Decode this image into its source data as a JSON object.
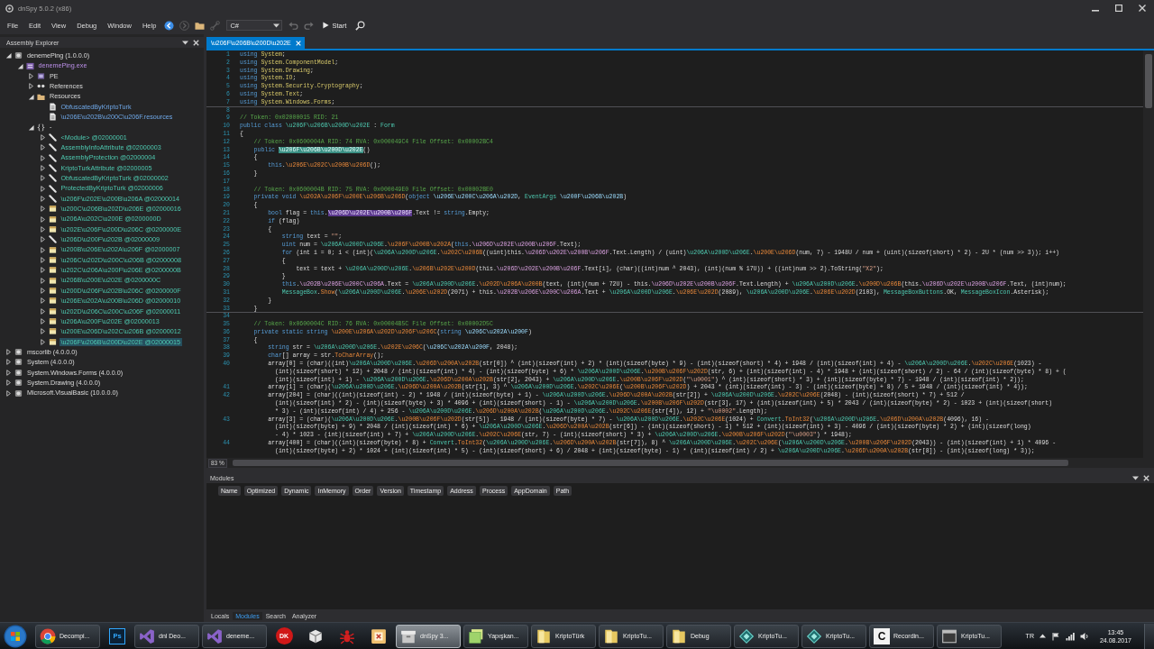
{
  "window": {
    "title": "dnSpy 5.0.2 (x86)"
  },
  "menu": [
    "File",
    "Edit",
    "View",
    "Debug",
    "Window",
    "Help"
  ],
  "toolbar": [
    {
      "kind": "back",
      "disabled": false
    },
    {
      "kind": "forward",
      "disabled": true
    },
    {
      "kind": "open",
      "disabled": false
    },
    {
      "kind": "link",
      "disabled": true
    },
    {
      "kind": "language",
      "value": "C#",
      "disabled": false
    },
    {
      "kind": "undo",
      "disabled": true
    },
    {
      "kind": "redo",
      "disabled": true
    },
    {
      "kind": "start",
      "label": "Start",
      "disabled": false
    },
    {
      "kind": "search",
      "disabled": false
    }
  ],
  "assembly_explorer": {
    "title": "Assembly Explorer",
    "tree": [
      {
        "label": "denemePing (1.0.0.0)",
        "kind": "assembly",
        "expanded": true,
        "selected": false,
        "children": [
          {
            "label": "denemePing.exe",
            "kind": "module",
            "expanded": true,
            "selected": false,
            "children": [
              {
                "label": "PE",
                "kind": "pe",
                "expanded": false,
                "selected": false
              },
              {
                "label": "References",
                "kind": "references",
                "expanded": false,
                "selected": false
              },
              {
                "label": "Resources",
                "kind": "resources",
                "expanded": true,
                "selected": false,
                "children": [
                  {
                    "label": "ObfuscatedByKriptoTurk",
                    "kind": "resource",
                    "selected": false
                  },
                  {
                    "label": "\\u206E\\u202B\\u200C\\u206F.resources",
                    "kind": "resource",
                    "selected": false
                  }
                ]
              },
              {
                "label": "-",
                "kind": "namespace",
                "expanded": true,
                "selected": false,
                "children": [
                  {
                    "label": "<Module> @02000001",
                    "kind": "class",
                    "expanded": false,
                    "selected": false
                  },
                  {
                    "label": "AssemblyInfoAttribute @02000003",
                    "kind": "class",
                    "expanded": false,
                    "selected": false
                  },
                  {
                    "label": "AssemblyProtection @02000004",
                    "kind": "class",
                    "expanded": false,
                    "selected": false
                  },
                  {
                    "label": "KriptoTurkAttribute @02000005",
                    "kind": "class",
                    "expanded": false,
                    "selected": false
                  },
                  {
                    "label": "ObfuscatedByKriptoTurk @02000002",
                    "kind": "class",
                    "expanded": false,
                    "selected": false
                  },
                  {
                    "label": "ProtectedByKriptoTurk @02000006",
                    "kind": "class",
                    "expanded": false,
                    "selected": false
                  },
                  {
                    "label": "\\u206F\\u202E\\u200B\\u206A @02000014",
                    "kind": "class",
                    "expanded": false,
                    "selected": false
                  },
                  {
                    "label": "\\u200C\\u206B\\u202D\\u206E @02000016",
                    "kind": "form",
                    "expanded": false,
                    "selected": false
                  },
                  {
                    "label": "\\u206A\\u202C\\u200E @0200000D",
                    "kind": "form",
                    "expanded": false,
                    "selected": false
                  },
                  {
                    "label": "\\u202E\\u206F\\u200D\\u206C @0200000E",
                    "kind": "form",
                    "expanded": false,
                    "selected": false
                  },
                  {
                    "label": "\\u206D\\u200F\\u202B @02000009",
                    "kind": "class",
                    "expanded": false,
                    "selected": false
                  },
                  {
                    "label": "\\u200B\\u206E\\u202A\\u206F @02000007",
                    "kind": "form",
                    "expanded": false,
                    "selected": false
                  },
                  {
                    "label": "\\u206C\\u202D\\u200C\\u206B @02000008",
                    "kind": "form",
                    "expanded": false,
                    "selected": false
                  },
                  {
                    "label": "\\u202C\\u206A\\u200F\\u206E @0200000B",
                    "kind": "form",
                    "expanded": false,
                    "selected": false
                  },
                  {
                    "label": "\\u206B\\u200E\\u202E @0200000C",
                    "kind": "form",
                    "expanded": false,
                    "selected": false
                  },
                  {
                    "label": "\\u200D\\u206F\\u202B\\u206C @0200000F",
                    "kind": "form",
                    "expanded": false,
                    "selected": false
                  },
                  {
                    "label": "\\u206E\\u202A\\u200B\\u206D @02000010",
                    "kind": "form",
                    "expanded": false,
                    "selected": false
                  },
                  {
                    "label": "\\u202D\\u206C\\u200C\\u206F @02000011",
                    "kind": "form",
                    "expanded": false,
                    "selected": false
                  },
                  {
                    "label": "\\u206A\\u200F\\u202E @02000013",
                    "kind": "form",
                    "expanded": false,
                    "selected": false
                  },
                  {
                    "label": "\\u200E\\u206D\\u202C\\u206B @02000012",
                    "kind": "form",
                    "expanded": false,
                    "selected": false
                  },
                  {
                    "label": "\\u206F\\u206B\\u200D\\u202E @02000015",
                    "kind": "form",
                    "expanded": false,
                    "selected": true
                  }
                ]
              }
            ]
          }
        ]
      },
      {
        "label": "mscorlib (4.0.0.0)",
        "kind": "assembly",
        "expanded": false,
        "selected": false
      },
      {
        "label": "System (4.0.0.0)",
        "kind": "assembly",
        "expanded": false,
        "selected": false
      },
      {
        "label": "System.Windows.Forms (4.0.0.0)",
        "kind": "assembly",
        "expanded": false,
        "selected": false
      },
      {
        "label": "System.Drawing (4.0.0.0)",
        "kind": "assembly",
        "expanded": false,
        "selected": false
      },
      {
        "label": "Microsoft.VisualBasic (10.0.0.0)",
        "kind": "assembly",
        "expanded": false,
        "selected": false
      }
    ]
  },
  "editor": {
    "tabs": [
      {
        "label": "\\u206F\\u206B\\u200D\\u202E",
        "selected": true
      }
    ],
    "lines": [
      {
        "number": "1",
        "segments": [
          {
            "kind": "keyword",
            "text": "using "
          },
          {
            "kind": "namespace",
            "text": "System"
          },
          {
            "kind": "plain",
            "text": ";"
          }
        ]
      },
      {
        "number": "2",
        "segments": [
          {
            "kind": "keyword",
            "text": "using "
          },
          {
            "kind": "namespace",
            "text": "System.ComponentModel"
          },
          {
            "kind": "plain",
            "text": ";"
          }
        ]
      },
      {
        "number": "3",
        "segments": [
          {
            "kind": "keyword",
            "text": "using "
          },
          {
            "kind": "namespace",
            "text": "System.Drawing"
          },
          {
            "kind": "plain",
            "text": ";"
          }
        ]
      },
      {
        "number": "4",
        "segments": [
          {
            "kind": "keyword",
            "text": "using "
          },
          {
            "kind": "namespace",
            "text": "System.IO"
          },
          {
            "kind": "plain",
            "text": ";"
          }
        ]
      },
      {
        "number": "5",
        "segments": [
          {
            "kind": "keyword",
            "text": "using "
          },
          {
            "kind": "namespace",
            "text": "System.Security.Cryptography"
          },
          {
            "kind": "plain",
            "text": ";"
          }
        ]
      },
      {
        "number": "6",
        "segments": [
          {
            "kind": "keyword",
            "text": "using "
          },
          {
            "kind": "namespace",
            "text": "System.Text"
          },
          {
            "kind": "plain",
            "text": ";"
          }
        ]
      },
      {
        "number": "7",
        "segments": [
          {
            "kind": "keyword",
            "text": "using "
          },
          {
            "kind": "namespace",
            "text": "System.Windows.Forms"
          },
          {
            "kind": "plain",
            "text": ";"
          }
        ],
        "divider_below": true
      },
      {
        "number": "8"
      },
      {
        "number": "9",
        "segments": [
          {
            "kind": "comment",
            "text": "// Token: 0x02000015 RID: 21"
          }
        ]
      },
      {
        "number": "10",
        "segments": [
          {
            "kind": "keyword",
            "text": "public class "
          },
          {
            "kind": "type",
            "text": "\\u206F\\u206B\\u200D\\u202E"
          },
          {
            "kind": "plain",
            "text": " : "
          },
          {
            "kind": "type",
            "text": "Form"
          }
        ]
      },
      {
        "number": "11",
        "segments": [
          {
            "kind": "plain",
            "text": "{"
          }
        ]
      },
      {
        "number": "12",
        "segments": [
          {
            "kind": "comment",
            "text": "    // Token: 0x0600004A RID: 74 RVA: 0x000049C4 File Offset: 0x00002BC4"
          }
        ]
      },
      {
        "number": "13",
        "segments": [
          {
            "kind": "keyword",
            "text": "    public "
          },
          {
            "kind": "selection",
            "text": "\\u206F\\u206B\\u200D\\u202E"
          },
          {
            "kind": "plain",
            "text": "()"
          }
        ]
      },
      {
        "number": "14",
        "segments": [
          {
            "kind": "plain",
            "text": "    {"
          }
        ]
      },
      {
        "number": "15",
        "segments": [
          {
            "kind": "keyword",
            "text": "        this"
          },
          {
            "kind": "plain",
            "text": "."
          },
          {
            "kind": "method",
            "text": "\\u206E\\u202C\\u200B\\u206D"
          },
          {
            "kind": "plain",
            "text": "();"
          }
        ]
      },
      {
        "number": "16",
        "segments": [
          {
            "kind": "plain",
            "text": "    }"
          }
        ]
      },
      {
        "number": "17"
      },
      {
        "number": "18",
        "segments": [
          {
            "kind": "comment",
            "text": "    // Token: 0x0600004B RID: 75 RVA: 0x000049E0 File Offset: 0x00002BE0"
          }
        ]
      },
      {
        "number": "19",
        "segments": [
          {
            "kind": "keyword",
            "text": "    private void "
          },
          {
            "kind": "method",
            "text": "\\u202A\\u206F\\u200E\\u206B\\u206D"
          },
          {
            "kind": "plain",
            "text": "("
          },
          {
            "kind": "keyword",
            "text": "object "
          },
          {
            "kind": "param",
            "text": "\\u206E\\u200C\\u206A\\u202D"
          },
          {
            "kind": "plain",
            "text": ", "
          },
          {
            "kind": "type",
            "text": "EventArgs "
          },
          {
            "kind": "param",
            "text": "\\u200F\\u206B\\u202B"
          },
          {
            "kind": "plain",
            "text": ")"
          }
        ]
      },
      {
        "number": "20",
        "segments": [
          {
            "kind": "plain",
            "text": "    {"
          }
        ]
      },
      {
        "number": "21",
        "segments": [
          {
            "kind": "keyword",
            "text": "        bool "
          },
          {
            "kind": "plain",
            "text": "flag = "
          },
          {
            "kind": "keyword",
            "text": "this"
          },
          {
            "kind": "plain",
            "text": "."
          },
          {
            "kind": "reference",
            "text": "\\u206D\\u202E\\u200B\\u206F"
          },
          {
            "kind": "plain",
            "text": ".Text != "
          },
          {
            "kind": "keyword",
            "text": "string"
          },
          {
            "kind": "plain",
            "text": ".Empty;"
          }
        ]
      },
      {
        "number": "22",
        "segments": [
          {
            "kind": "keyword",
            "text": "        if "
          },
          {
            "kind": "plain",
            "text": "(flag)"
          }
        ]
      },
      {
        "number": "23",
        "segments": [
          {
            "kind": "plain",
            "text": "        {"
          }
        ]
      },
      {
        "number": "24",
        "segments": [
          {
            "kind": "keyword",
            "text": "            string "
          },
          {
            "kind": "plain",
            "text": "text = "
          },
          {
            "kind": "string",
            "text": "\"\""
          },
          {
            "kind": "plain",
            "text": ";"
          }
        ]
      },
      {
        "number": "25",
        "segments": [
          {
            "kind": "keyword",
            "text": "            uint "
          },
          {
            "kind": "plain",
            "text": "num = "
          },
          {
            "kind": "type",
            "text": "\\u206A\\u200D\\u206E"
          },
          {
            "kind": "plain",
            "text": "."
          },
          {
            "kind": "method",
            "text": "\\u206F\\u200B\\u202A"
          },
          {
            "kind": "plain",
            "text": "("
          },
          {
            "kind": "keyword",
            "text": "this"
          },
          {
            "kind": "plain",
            "text": "."
          },
          {
            "kind": "field",
            "text": "\\u206D\\u202E\\u200B\\u206F"
          },
          {
            "kind": "plain",
            "text": ".Text);"
          }
        ]
      },
      {
        "number": "26",
        "segments": [
          {
            "kind": "keyword",
            "text": "            for "
          },
          {
            "kind": "plain",
            "text": "(int i = 0; i < (int)("
          },
          {
            "kind": "type",
            "text": "\\u206A\\u200D\\u206E"
          },
          {
            "kind": "plain",
            "text": "."
          },
          {
            "kind": "method",
            "text": "\\u202C\\u206B"
          },
          {
            "kind": "plain",
            "text": "((uint)this."
          },
          {
            "kind": "field",
            "text": "\\u206D\\u202E\\u200B\\u206F"
          },
          {
            "kind": "plain",
            "text": ".Text.Length) / (uint)"
          },
          {
            "kind": "type",
            "text": "\\u206A\\u200D\\u206E"
          },
          {
            "kind": "plain",
            "text": "."
          },
          {
            "kind": "method",
            "text": "\\u200E\\u206D"
          },
          {
            "kind": "plain",
            "text": "(num, 7) - 1948U / num + (uint)(sizeof(short) * 2) - 2U * (num >> 3)); i++)"
          }
        ]
      },
      {
        "number": "27",
        "segments": [
          {
            "kind": "plain",
            "text": "            {"
          }
        ]
      },
      {
        "number": "28",
        "segments": [
          {
            "kind": "plain",
            "text": "                text = text + "
          },
          {
            "kind": "type",
            "text": "\\u206A\\u200D\\u206E"
          },
          {
            "kind": "plain",
            "text": "."
          },
          {
            "kind": "method",
            "text": "\\u206B\\u202E\\u200D"
          },
          {
            "kind": "plain",
            "text": "(this."
          },
          {
            "kind": "field",
            "text": "\\u206D\\u202E\\u200B\\u206F"
          },
          {
            "kind": "plain",
            "text": ".Text[i], (char)((int)num ^ 2043), (int)(num % 17U)) + ((int)num >> 2).ToString("
          },
          {
            "kind": "string",
            "text": "\"X2\""
          },
          {
            "kind": "plain",
            "text": ");"
          }
        ]
      },
      {
        "number": "29",
        "segments": [
          {
            "kind": "plain",
            "text": "            }"
          }
        ]
      },
      {
        "number": "30",
        "segments": [
          {
            "kind": "keyword",
            "text": "            this"
          },
          {
            "kind": "plain",
            "text": "."
          },
          {
            "kind": "field",
            "text": "\\u202B\\u206E\\u200C\\u206A"
          },
          {
            "kind": "plain",
            "text": ".Text = "
          },
          {
            "kind": "type",
            "text": "\\u206A\\u200D\\u206E"
          },
          {
            "kind": "plain",
            "text": "."
          },
          {
            "kind": "method",
            "text": "\\u202D\\u206A\\u200B"
          },
          {
            "kind": "plain",
            "text": "(text, (int)(num + 72U) - this."
          },
          {
            "kind": "field",
            "text": "\\u206D\\u202E\\u200B\\u206F"
          },
          {
            "kind": "plain",
            "text": ".Text.Length) + "
          },
          {
            "kind": "type",
            "text": "\\u206A\\u200D\\u206E"
          },
          {
            "kind": "plain",
            "text": "."
          },
          {
            "kind": "method",
            "text": "\\u200D\\u206B"
          },
          {
            "kind": "plain",
            "text": "(this."
          },
          {
            "kind": "field",
            "text": "\\u206D\\u202E\\u200B\\u206F"
          },
          {
            "kind": "plain",
            "text": ".Text, (int)num);"
          }
        ]
      },
      {
        "number": "31",
        "segments": [
          {
            "kind": "type",
            "text": "            MessageBox"
          },
          {
            "kind": "plain",
            "text": "."
          },
          {
            "kind": "method",
            "text": "Show"
          },
          {
            "kind": "plain",
            "text": "("
          },
          {
            "kind": "type",
            "text": "\\u206A\\u200D\\u206E"
          },
          {
            "kind": "plain",
            "text": "."
          },
          {
            "kind": "method",
            "text": "\\u206E\\u202D"
          },
          {
            "kind": "plain",
            "text": "(2071) + this."
          },
          {
            "kind": "field",
            "text": "\\u202B\\u206E\\u200C\\u206A"
          },
          {
            "kind": "plain",
            "text": ".Text + "
          },
          {
            "kind": "type",
            "text": "\\u206A\\u200D\\u206E"
          },
          {
            "kind": "plain",
            "text": "."
          },
          {
            "kind": "method",
            "text": "\\u206E\\u202D"
          },
          {
            "kind": "plain",
            "text": "(2089), "
          },
          {
            "kind": "type",
            "text": "\\u206A\\u200D\\u206E"
          },
          {
            "kind": "plain",
            "text": "."
          },
          {
            "kind": "method",
            "text": "\\u206E\\u202D"
          },
          {
            "kind": "plain",
            "text": "(2103), "
          },
          {
            "kind": "type",
            "text": "MessageBoxButtons"
          },
          {
            "kind": "plain",
            "text": ".OK, "
          },
          {
            "kind": "type",
            "text": "MessageBoxIcon"
          },
          {
            "kind": "plain",
            "text": ".Asterisk);"
          }
        ]
      },
      {
        "number": "32",
        "segments": [
          {
            "kind": "plain",
            "text": "        }"
          }
        ]
      },
      {
        "number": "33",
        "segments": [
          {
            "kind": "plain",
            "text": "    }"
          }
        ],
        "divider_below": true
      },
      {
        "number": "34"
      },
      {
        "number": "35",
        "segments": [
          {
            "kind": "comment",
            "text": "    // Token: 0x0600004C RID: 76 RVA: 0x00004B5C File Offset: 0x00002D5C"
          }
        ]
      },
      {
        "number": "36",
        "segments": [
          {
            "kind": "keyword",
            "text": "    private static string "
          },
          {
            "kind": "method",
            "text": "\\u200E\\u206A\\u202D\\u206F\\u206C"
          },
          {
            "kind": "plain",
            "text": "("
          },
          {
            "kind": "keyword",
            "text": "string "
          },
          {
            "kind": "param",
            "text": "\\u206C\\u202A\\u200F"
          },
          {
            "kind": "plain",
            "text": ")"
          }
        ]
      },
      {
        "number": "37",
        "segments": [
          {
            "kind": "plain",
            "text": "    {"
          }
        ]
      },
      {
        "number": "38",
        "segments": [
          {
            "kind": "keyword",
            "text": "        string "
          },
          {
            "kind": "plain",
            "text": "str = "
          },
          {
            "kind": "type",
            "text": "\\u206A\\u200D\\u206E"
          },
          {
            "kind": "plain",
            "text": "."
          },
          {
            "kind": "method",
            "text": "\\u202E\\u206C"
          },
          {
            "kind": "plain",
            "text": "("
          },
          {
            "kind": "param",
            "text": "\\u206C\\u202A\\u200F"
          },
          {
            "kind": "plain",
            "text": ", 2048);"
          }
        ]
      },
      {
        "number": "39",
        "segments": [
          {
            "kind": "keyword",
            "text": "        char"
          },
          {
            "kind": "plain",
            "text": "[] array = str."
          },
          {
            "kind": "method",
            "text": "ToCharArray"
          },
          {
            "kind": "plain",
            "text": "();"
          }
        ]
      },
      {
        "number": "40",
        "segments": [
          {
            "kind": "plain",
            "text": "        array[0] = (char)((int)"
          },
          {
            "kind": "type",
            "text": "\\u206A\\u200D\\u206E"
          },
          {
            "kind": "plain",
            "text": "."
          },
          {
            "kind": "method",
            "text": "\\u206D\\u200A\\u202B"
          },
          {
            "kind": "plain",
            "text": "(str[0]) ^ (int)(sizeof(int) + 2) * (int)(sizeof(byte) * 9) - (int)(sizeof(short) * 4) + 1948 / (int)(sizeof(int) + 4) - "
          },
          {
            "kind": "type",
            "text": "\\u206A\\u200D\\u206E"
          },
          {
            "kind": "plain",
            "text": "."
          },
          {
            "kind": "method",
            "text": "\\u202C\\u206E"
          },
          {
            "kind": "plain",
            "text": "(1023) -"
          }
        ],
        "wraps": [
          [
            {
              "kind": "plain",
              "text": "          (int)(sizeof(short) * 12) + 2048 / (int)(sizeof(int) * 4) - (int)(sizeof(byte) + 6) * "
            },
            {
              "kind": "type",
              "text": "\\u206A\\u200D\\u206E"
            },
            {
              "kind": "plain",
              "text": "."
            },
            {
              "kind": "method",
              "text": "\\u200B\\u206F\\u202D"
            },
            {
              "kind": "plain",
              "text": "(str, 6) + (int)(sizeof(int) - 4) * 1948 + (int)(sizeof(short) / 2) - 64 / (int)(sizeof(byte) * 8) + ("
            }
          ],
          [
            {
              "kind": "plain",
              "text": "          (int)(sizeof(int) + 1) - "
            },
            {
              "kind": "type",
              "text": "\\u206A\\u200D\\u206E"
            },
            {
              "kind": "plain",
              "text": "."
            },
            {
              "kind": "method",
              "text": "\\u206D\\u200A\\u202B"
            },
            {
              "kind": "plain",
              "text": "(str[2], 2043) + "
            },
            {
              "kind": "type",
              "text": "\\u206A\\u200D\\u206E"
            },
            {
              "kind": "plain",
              "text": "."
            },
            {
              "kind": "method",
              "text": "\\u200B\\u206F\\u202D"
            },
            {
              "kind": "plain",
              "text": "("
            },
            {
              "kind": "string",
              "text": "\"\\u0001\""
            },
            {
              "kind": "plain",
              "text": ") ^ (int)(sizeof(short) * 3) + (int)(sizeof(byte) * 7) - 1948 / (int)(sizeof(int) * 2));"
            }
          ]
        ]
      },
      {
        "number": "41",
        "segments": [
          {
            "kind": "plain",
            "text": "        array[1] = (char)("
          },
          {
            "kind": "type",
            "text": "\\u206A\\u200D\\u206E"
          },
          {
            "kind": "plain",
            "text": "."
          },
          {
            "kind": "method",
            "text": "\\u206D\\u200A\\u202B"
          },
          {
            "kind": "plain",
            "text": "(str[1], 3) ^ "
          },
          {
            "kind": "type",
            "text": "\\u206A\\u200D\\u206E"
          },
          {
            "kind": "plain",
            "text": "."
          },
          {
            "kind": "method",
            "text": "\\u202C\\u206E"
          },
          {
            "kind": "plain",
            "text": "("
          },
          {
            "kind": "method",
            "text": "\\u200B\\u206F\\u202D"
          },
          {
            "kind": "plain",
            "text": ") + 2043 * (int)(sizeof(int) - 3) - (int)(sizeof(byte) + 8) / 5 + 1948 / (int)(sizeof(int) * 4));"
          }
        ]
      },
      {
        "number": "42",
        "segments": [
          {
            "kind": "plain",
            "text": "        array[204] = (char)((int)(sizeof(int) - 2) * 1948 / (int)(sizeof(byte) + 1) - "
          },
          {
            "kind": "type",
            "text": "\\u206A\\u200D\\u206E"
          },
          {
            "kind": "plain",
            "text": "."
          },
          {
            "kind": "method",
            "text": "\\u206D\\u200A\\u202B"
          },
          {
            "kind": "plain",
            "text": "(str[2]) + "
          },
          {
            "kind": "type",
            "text": "\\u206A\\u200D\\u206E"
          },
          {
            "kind": "plain",
            "text": "."
          },
          {
            "kind": "method",
            "text": "\\u202C\\u206E"
          },
          {
            "kind": "plain",
            "text": "(2048) - (int)(sizeof(short) * 7) + 512 /"
          }
        ],
        "wraps": [
          [
            {
              "kind": "plain",
              "text": "          (int)(sizeof(int) * 2) - (int)(sizeof(byte) + 3) * 4096 + (int)(sizeof(short) - 1) - "
            },
            {
              "kind": "type",
              "text": "\\u206A\\u200D\\u206E"
            },
            {
              "kind": "plain",
              "text": "."
            },
            {
              "kind": "method",
              "text": "\\u200B\\u206F\\u202D"
            },
            {
              "kind": "plain",
              "text": "(str[3], 17) + (int)(sizeof(int) + 5) * 2043 / (int)(sizeof(byte) * 2) - 1023 + (int)(sizeof(short)"
            }
          ],
          [
            {
              "kind": "plain",
              "text": "          * 3) - (int)(sizeof(int) / 4) + 256 - "
            },
            {
              "kind": "type",
              "text": "\\u206A\\u200D\\u206E"
            },
            {
              "kind": "plain",
              "text": "."
            },
            {
              "kind": "method",
              "text": "\\u206D\\u200A\\u202B"
            },
            {
              "kind": "plain",
              "text": "("
            },
            {
              "kind": "type",
              "text": "\\u206A\\u200D\\u206E"
            },
            {
              "kind": "plain",
              "text": "."
            },
            {
              "kind": "method",
              "text": "\\u202C\\u206E"
            },
            {
              "kind": "plain",
              "text": "(str[4]), 12) + "
            },
            {
              "kind": "string",
              "text": "\"\\u0002\""
            },
            {
              "kind": "plain",
              "text": ".Length);"
            }
          ]
        ]
      },
      {
        "number": "43",
        "segments": [
          {
            "kind": "plain",
            "text": "        array[3] = (char)("
          },
          {
            "kind": "type",
            "text": "\\u206A\\u200D\\u206E"
          },
          {
            "kind": "plain",
            "text": "."
          },
          {
            "kind": "method",
            "text": "\\u200B\\u206F\\u202D"
          },
          {
            "kind": "plain",
            "text": "(str[5]) - 1948 / (int)(sizeof(byte) * 7) - "
          },
          {
            "kind": "type",
            "text": "\\u206A\\u200D\\u206E"
          },
          {
            "kind": "plain",
            "text": "."
          },
          {
            "kind": "method",
            "text": "\\u202C\\u206E"
          },
          {
            "kind": "plain",
            "text": "(1024) + "
          },
          {
            "kind": "type",
            "text": "Convert"
          },
          {
            "kind": "plain",
            "text": "."
          },
          {
            "kind": "method",
            "text": "ToInt32"
          },
          {
            "kind": "plain",
            "text": "("
          },
          {
            "kind": "type",
            "text": "\\u206A\\u200D\\u206E"
          },
          {
            "kind": "plain",
            "text": "."
          },
          {
            "kind": "method",
            "text": "\\u206D\\u200A\\u202B"
          },
          {
            "kind": "plain",
            "text": "(4096), 16) -"
          }
        ],
        "wraps": [
          [
            {
              "kind": "plain",
              "text": "          (int)(sizeof(byte) + 9) * 2048 / (int)(sizeof(int) * 6) + "
            },
            {
              "kind": "type",
              "text": "\\u206A\\u200D\\u206E"
            },
            {
              "kind": "plain",
              "text": "."
            },
            {
              "kind": "method",
              "text": "\\u206D\\u200A\\u202B"
            },
            {
              "kind": "plain",
              "text": "(str[6]) - (int)(sizeof(short) - 1) * 512 + (int)(sizeof(int) + 3) - 4096 / (int)(sizeof(byte) * 2) + (int)(sizeof(long)"
            }
          ],
          [
            {
              "kind": "plain",
              "text": "          - 4) * 1023 - (int)(sizeof(int) + 7) + "
            },
            {
              "kind": "type",
              "text": "\\u206A\\u200D\\u206E"
            },
            {
              "kind": "plain",
              "text": "."
            },
            {
              "kind": "method",
              "text": "\\u202C\\u206E"
            },
            {
              "kind": "plain",
              "text": "(str, 7) - (int)(sizeof(short) * 3) + "
            },
            {
              "kind": "type",
              "text": "\\u206A\\u200D\\u206E"
            },
            {
              "kind": "plain",
              "text": "."
            },
            {
              "kind": "method",
              "text": "\\u200B\\u206F\\u202D"
            },
            {
              "kind": "plain",
              "text": "("
            },
            {
              "kind": "string",
              "text": "\"\\u0003\""
            },
            {
              "kind": "plain",
              "text": ") * 1948);"
            }
          ]
        ]
      },
      {
        "number": "44",
        "segments": [
          {
            "kind": "plain",
            "text": "        array[400] = (char)((int)(sizeof(byte) * 8) + "
          },
          {
            "kind": "type",
            "text": "Convert"
          },
          {
            "kind": "plain",
            "text": "."
          },
          {
            "kind": "method",
            "text": "ToInt32"
          },
          {
            "kind": "plain",
            "text": "("
          },
          {
            "kind": "type",
            "text": "\\u206A\\u200D\\u206E"
          },
          {
            "kind": "plain",
            "text": "."
          },
          {
            "kind": "method",
            "text": "\\u206D\\u200A\\u202B"
          },
          {
            "kind": "plain",
            "text": "(str[7]), 8) ^ "
          },
          {
            "kind": "type",
            "text": "\\u206A\\u200D\\u206E"
          },
          {
            "kind": "plain",
            "text": "."
          },
          {
            "kind": "method",
            "text": "\\u202C\\u206E"
          },
          {
            "kind": "plain",
            "text": "("
          },
          {
            "kind": "type",
            "text": "\\u206A\\u200D\\u206E"
          },
          {
            "kind": "plain",
            "text": "."
          },
          {
            "kind": "method",
            "text": "\\u200B\\u206F\\u202D"
          },
          {
            "kind": "plain",
            "text": "(2043)) - (int)(sizeof(int) + 1) * 4096 -"
          }
        ],
        "wraps": [
          [
            {
              "kind": "plain",
              "text": "          (int)(sizeof(byte) + 2) * 1024 + (int)(sizeof(int) * 5) - (int)(sizeof(short) + 6) / 2048 + (int)(sizeof(byte) - 1) * (int)(sizeof(int) / 2) + "
            },
            {
              "kind": "type",
              "text": "\\u206A\\u200D\\u206E"
            },
            {
              "kind": "plain",
              "text": "."
            },
            {
              "kind": "method",
              "text": "\\u206D\\u200A\\u202B"
            },
            {
              "kind": "plain",
              "text": "(str[8]) - (int)(sizeof(long) * 3));"
            }
          ]
        ]
      }
    ],
    "zoom": "83 %"
  },
  "modules_panel": {
    "title": "Modules",
    "columns": [
      "Name",
      "Optimized",
      "Dynamic",
      "InMemory",
      "Order",
      "Version",
      "Timestamp",
      "Address",
      "Process",
      "AppDomain",
      "Path"
    ]
  },
  "bottom_tabs": [
    {
      "label": "Locals",
      "selected": false
    },
    {
      "label": "Modules",
      "selected": true
    },
    {
      "label": "Search",
      "selected": false
    },
    {
      "label": "Analyzer",
      "selected": false
    }
  ],
  "taskbar": {
    "items": [
      {
        "kind": "browser",
        "label": "Decompi...",
        "active": false
      },
      {
        "kind": "tile",
        "icon_text": "Ps",
        "active": false
      },
      {
        "kind": "studio",
        "label": "dnl Deo...",
        "active": false
      },
      {
        "kind": "studio",
        "label": "deneme...",
        "active": false
      },
      {
        "kind": "badge",
        "icon_text": "DK",
        "active": false
      },
      {
        "kind": "cube",
        "active": false
      },
      {
        "kind": "bug",
        "active": false
      },
      {
        "kind": "square",
        "active": false
      },
      {
        "kind": "box",
        "label": "dnSpy 3...",
        "active": true
      },
      {
        "kind": "notes",
        "label": "Yapışkan...",
        "active": false
      },
      {
        "kind": "folder",
        "label": "KriptoTürk",
        "active": false
      },
      {
        "kind": "folder",
        "label": "KriptoTu...",
        "active": false
      },
      {
        "kind": "folder",
        "label": "Debug",
        "active": false
      },
      {
        "kind": "diamond",
        "label": "KriptoTu...",
        "active": false
      },
      {
        "kind": "diamond",
        "label": "KriptoTu...",
        "active": false
      },
      {
        "kind": "card",
        "icon_text": "C",
        "label": "Recordin...",
        "active": false
      },
      {
        "kind": "window",
        "label": "KriptoTu...",
        "active": false
      }
    ],
    "tray": {
      "language": "TR",
      "time": "13:45",
      "date": "24.08.2017"
    }
  }
}
